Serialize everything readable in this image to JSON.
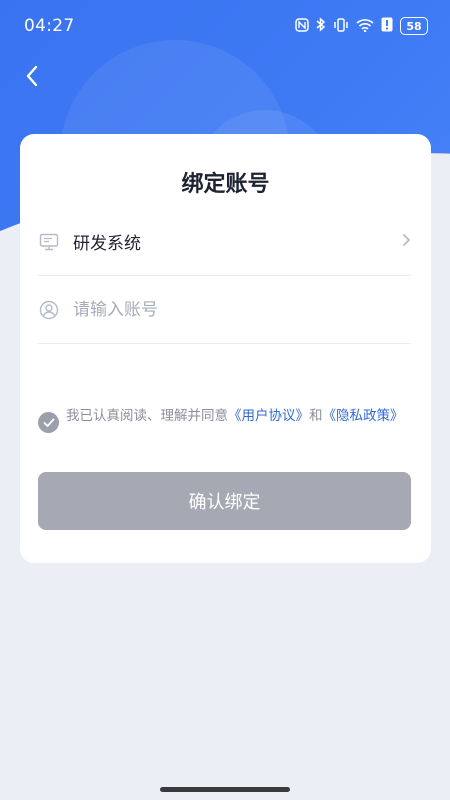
{
  "status_bar": {
    "time": "04:27",
    "battery": "58",
    "icons": [
      "nfc-icon",
      "bluetooth-icon",
      "vibrate-icon",
      "wifi-icon",
      "alert-icon",
      "battery-icon"
    ]
  },
  "header": {
    "back_icon": "chevron-left-icon"
  },
  "card": {
    "title": "绑定账号",
    "system_row": {
      "icon": "monitor-icon",
      "value": "研发系统",
      "chevron": "chevron-right-icon"
    },
    "account_row": {
      "icon": "user-icon",
      "placeholder": "请输入账号",
      "value": ""
    },
    "agreement": {
      "prefix": "我已认真阅读、理解并同意",
      "user_agreement": "《用户协议》",
      "and": "和",
      "privacy_policy": "《隐私政策》"
    },
    "confirm_label": "确认绑定"
  },
  "colors": {
    "primary": "#3f7bf5",
    "link": "#3268d8",
    "button_disabled": "#a6a9b4",
    "page_bg": "#eceef6"
  }
}
